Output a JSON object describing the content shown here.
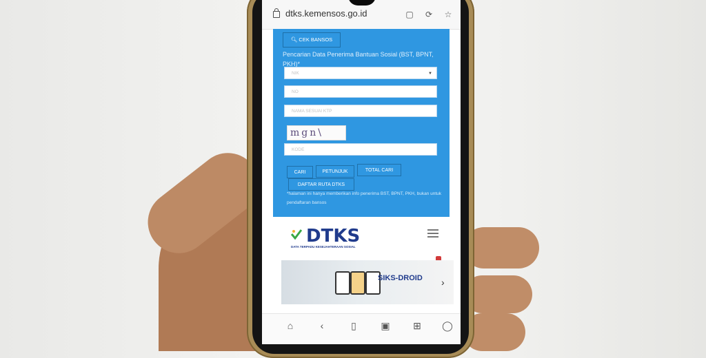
{
  "browser": {
    "url": "dtks.kemensos.go.id"
  },
  "form": {
    "cek_button": "CEK BANSOS",
    "title": "Pencarian Data Penerima Bantuan Sosial (BST, BPNT, PKH)*",
    "fields": [
      {
        "placeholder": "NIK"
      },
      {
        "placeholder": "NO"
      },
      {
        "placeholder": "NAMA SESUAI KTP"
      },
      {
        "placeholder": "KODE"
      }
    ],
    "captcha_text": "mgn\\",
    "buttons": {
      "cari": "CARI",
      "petunjuk": "PETUNJUK",
      "total_cari": "TOTAL CARI",
      "daftar_ruta": "DAFTAR RUTA DTKS"
    },
    "note": "*halaman ini hanya memberikan info penerima BST, BPNT, PKH, bukan untuk pendaftaran bansos"
  },
  "site": {
    "logo_text": "DTKS",
    "logo_subtitle": "DATA TERPADU KESEJAHTERAAN SOSIAL",
    "banner_brand": "SIKS-DROID"
  },
  "icons": {
    "lock": "lock-icon",
    "tabs": "tabs-icon",
    "refresh": "refresh-icon",
    "star": "star-icon",
    "home": "home-icon",
    "back": "back-icon",
    "reader": "reader-icon",
    "tab_count": "tab-count-icon",
    "bookmark": "bookmark-icon",
    "profile": "profile-icon"
  },
  "colors": {
    "form_background": "#2f97e1",
    "logo_blue": "#203b8c",
    "logo_green": "#39a845"
  }
}
